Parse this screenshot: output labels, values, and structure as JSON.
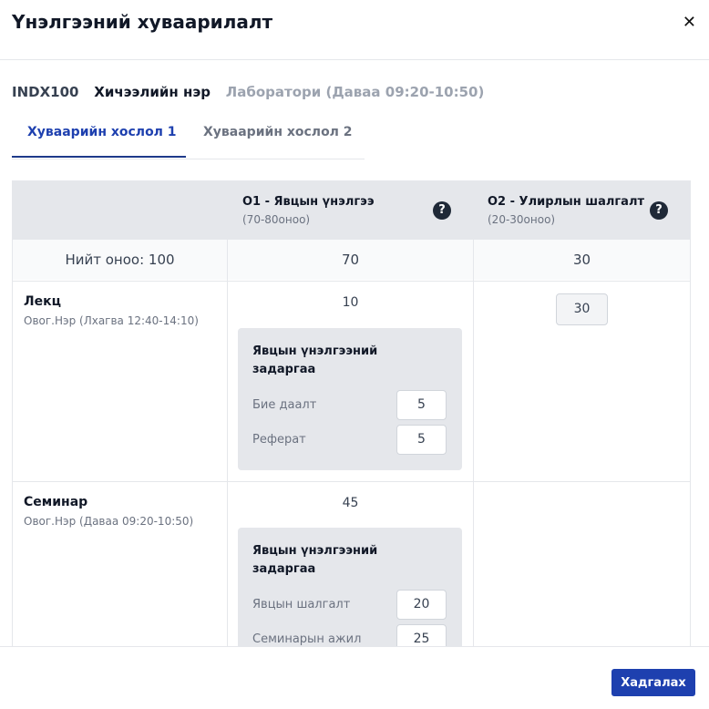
{
  "modal": {
    "title": "Үнэлгээний хуваарилалт",
    "close_icon": "close-icon"
  },
  "course": {
    "code": "INDX100",
    "name": "Хичээлийн нэр",
    "lab": "Лаборатори (Даваа 09:20-10:50)"
  },
  "tabs": [
    {
      "label": "Хуваарийн хослол 1",
      "active": true
    },
    {
      "label": "Хуваарийн хослол 2",
      "active": false
    }
  ],
  "table": {
    "columns": [
      {
        "title": "О1 - Явцын үнэлгээ",
        "range": "(70-80оноо)",
        "icon": "help-icon"
      },
      {
        "title": "О2 - Улирлын шалгалт",
        "range": "(20-30оноо)",
        "icon": "help-icon"
      }
    ],
    "total": {
      "label": "Нийт оноо: 100",
      "o1": "70",
      "o2": "30"
    },
    "rows": [
      {
        "title": "Лекц",
        "subtitle": "Овог.Нэр (Лхагва 12:40-14:10)",
        "o1_value": "10",
        "o2_value": "30",
        "breakdown_title": "Явцын үнэлгээний задаргаа",
        "items": [
          {
            "label": "Бие даалт",
            "value": "5"
          },
          {
            "label": "Реферат",
            "value": "5"
          }
        ]
      },
      {
        "title": "Семинар",
        "subtitle": "Овог.Нэр (Даваа 09:20-10:50)",
        "o1_value": "45",
        "breakdown_title": "Явцын үнэлгээний задаргаа",
        "items": [
          {
            "label": "Явцын шалгалт",
            "value": "20"
          },
          {
            "label": "Семинарын ажил",
            "value": "25"
          }
        ]
      }
    ]
  },
  "footer": {
    "save_label": "Хадгалах"
  },
  "colors": {
    "primary": "#1e40af",
    "header_bg": "#e5e7eb",
    "muted": "#6b7280"
  }
}
